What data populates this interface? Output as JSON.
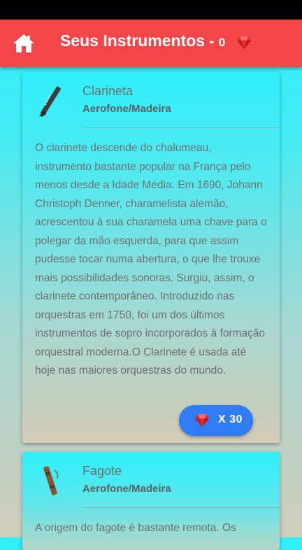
{
  "app_bar": {
    "title": "Seus Instrumentos",
    "separator": "-",
    "gem_count": "0"
  },
  "instruments": [
    {
      "name": "Clarineta",
      "category": "Aerofone/Madeira",
      "icon": "clarinet-icon",
      "description": "O clarinete descende do chalumeau, instrumento bastante popular na França pelo menos desde a Idade Média. Em 1690, Johann Christoph Denner, charamelista alemão, acrescentou à sua charamela uma chave para o polegar da mão esquerda, para que assim pudesse tocar numa abertura, o que lhe trouxe mais possibilidades sonoras. Surgiu, assim, o clarinete contemporâneo. Introduzido nas orquestras em 1750, foi um dos últimos instrumentos de sopro incorporados à formação orquestral moderna.O Clarinete é usada até hoje nas maiores orquestras do mundo.",
      "price_label": "X 30"
    },
    {
      "name": "Fagote",
      "category": "Aerofone/Madeira",
      "icon": "bassoon-icon",
      "description": "A origem do fagote é bastante remota. Os"
    }
  ],
  "colors": {
    "app_bar": "#f44548",
    "price_button": "#2f7cf4",
    "gem": "#e52b2b"
  }
}
